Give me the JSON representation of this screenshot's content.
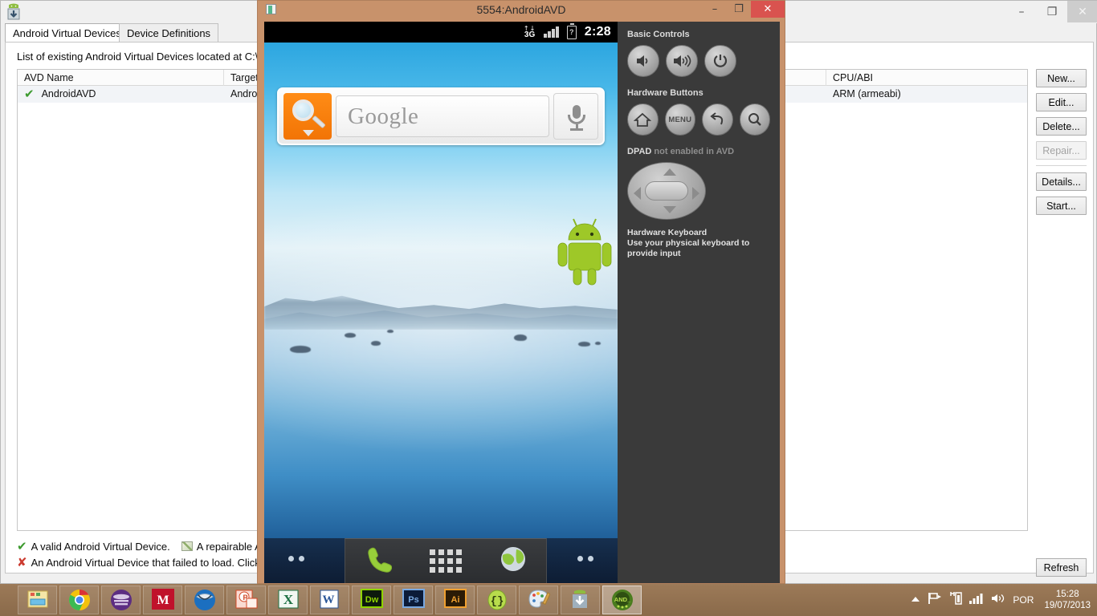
{
  "avd_window": {
    "app_icon": "android-download-icon",
    "window_controls": {
      "minimize": "–",
      "restore": "❐",
      "close": "✕"
    },
    "tabs": [
      {
        "label": "Android Virtual Devices",
        "active": true
      },
      {
        "label": "Device Definitions",
        "active": false
      }
    ],
    "list_caption": "List of existing Android Virtual Devices located at C:\\Users",
    "table": {
      "columns": [
        "AVD Name",
        "Target N",
        "CPU/ABI"
      ],
      "rows": [
        {
          "status_icon": "valid-check-icon",
          "name": "AndroidAVD",
          "target": "Android",
          "cpu_abi": "ARM (armeabi)"
        }
      ]
    },
    "buttons": [
      {
        "label": "New...",
        "enabled": true
      },
      {
        "label": "Edit...",
        "enabled": true
      },
      {
        "label": "Delete...",
        "enabled": true
      },
      {
        "label": "Repair...",
        "enabled": false
      },
      {
        "label": "Details...",
        "enabled": true
      },
      {
        "label": "Start...",
        "enabled": true
      }
    ],
    "refresh_label": "Refresh",
    "legend": {
      "line1_a": "A valid Android Virtual Device.",
      "line1_b": "A repairable Andro",
      "line2": "An Android Virtual Device that failed to load. Click 'De"
    }
  },
  "emulator": {
    "title": "5554:AndroidAVD",
    "window_controls": {
      "minimize": "–",
      "maximize": "❐",
      "close": "✕"
    },
    "status_bar": {
      "network_label": "3G",
      "network_arrows": "↑↓",
      "battery_label": "?",
      "time": "2:28"
    },
    "search_widget": {
      "brand": "Google",
      "magnifier_icon": "search-magnifier-icon",
      "mic_icon": "microphone-icon"
    },
    "dock": {
      "phone_icon": "phone-icon",
      "apps_icon": "app-drawer-icon",
      "browser_icon": "browser-globe-icon"
    },
    "controls": {
      "basic_controls_label": "Basic Controls",
      "basic_buttons": [
        {
          "name": "volume-down-button",
          "icon": "speaker-low-icon"
        },
        {
          "name": "volume-up-button",
          "icon": "speaker-high-icon"
        },
        {
          "name": "power-button",
          "icon": "power-icon"
        }
      ],
      "hardware_buttons_label": "Hardware Buttons",
      "hardware_buttons": [
        {
          "name": "home-button",
          "icon": "home-icon",
          "text": ""
        },
        {
          "name": "menu-button",
          "icon": "menu-icon",
          "text": "MENU"
        },
        {
          "name": "back-button",
          "icon": "back-arrow-icon",
          "text": ""
        },
        {
          "name": "search-button",
          "icon": "search-icon",
          "text": ""
        }
      ],
      "dpad_label_strong": "DPAD",
      "dpad_label_dim": "not enabled in AVD",
      "keyboard_title": "Hardware Keyboard",
      "keyboard_note": "Use your physical keyboard to provide input"
    }
  },
  "taskbar": {
    "items": [
      {
        "name": "file-explorer",
        "icon": "folder-icon",
        "active": false
      },
      {
        "name": "google-chrome",
        "icon": "chrome-icon",
        "active": false
      },
      {
        "name": "eclipse",
        "icon": "eclipse-icon",
        "active": false
      },
      {
        "name": "mendeley",
        "icon": "mendeley-m-icon",
        "active": false
      },
      {
        "name": "thunderbird",
        "icon": "thunderbird-icon",
        "active": false
      },
      {
        "name": "powerpoint",
        "icon": "powerpoint-icon",
        "active": false
      },
      {
        "name": "excel",
        "icon": "excel-icon",
        "active": false
      },
      {
        "name": "word",
        "icon": "word-icon",
        "active": false
      },
      {
        "name": "dreamweaver",
        "icon": "dreamweaver-icon",
        "active": false
      },
      {
        "name": "photoshop",
        "icon": "photoshop-icon",
        "active": false
      },
      {
        "name": "illustrator",
        "icon": "illustrator-icon",
        "active": false
      },
      {
        "name": "json-editor",
        "icon": "braces-icon",
        "active": false
      },
      {
        "name": "paint-app",
        "icon": "palette-icon",
        "active": false
      },
      {
        "name": "android-sdk-manager",
        "icon": "android-download-icon",
        "active": false
      },
      {
        "name": "avd-manager",
        "icon": "android-avd-icon",
        "active": true
      }
    ],
    "labels": {
      "dreamweaver": "Dw",
      "photoshop": "Ps",
      "illustrator": "Ai",
      "word": "W",
      "excel": "X",
      "powerpoint": "P",
      "mendeley": "M",
      "braces": "{}",
      "avd": "AND_"
    },
    "tray": {
      "show_hidden_icon": "chevron-up-icon",
      "action_center_icon": "flag-icon",
      "network_icon": "network-icon",
      "signal_icon": "signal-bars-icon",
      "volume_icon": "speaker-icon",
      "language": "POR",
      "time": "15:28",
      "date": "19/07/2013"
    }
  },
  "colors": {
    "emulator_titlebar": "#c8926b",
    "close_button": "#d9534f",
    "taskbar": "#8a6a4a",
    "android_green": "#a4c639",
    "google_orange": "#f27405"
  }
}
